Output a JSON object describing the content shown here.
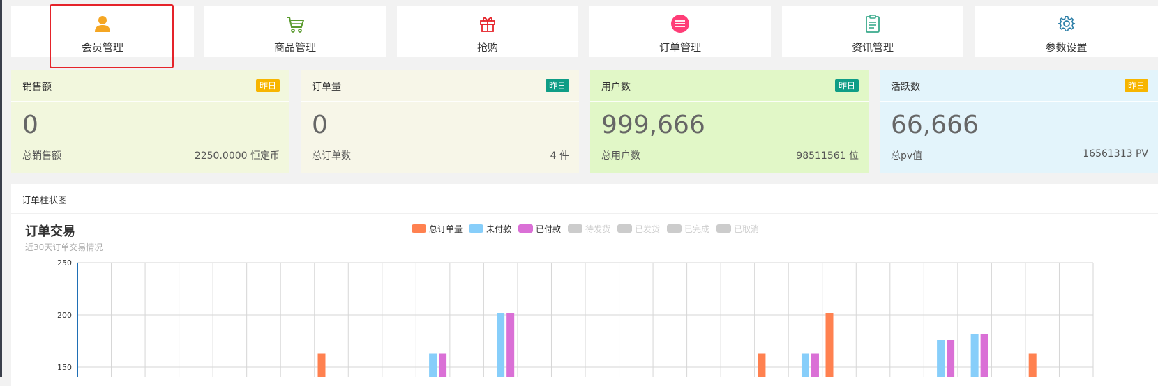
{
  "nav": [
    {
      "label": "会员管理",
      "icon": "user-icon",
      "color": "#f5a623"
    },
    {
      "label": "商品管理",
      "icon": "shopping-cart-icon",
      "color": "#5b9b2f"
    },
    {
      "label": "抢购",
      "icon": "gift-icon",
      "color": "#e5232a"
    },
    {
      "label": "订单管理",
      "icon": "list-circle-icon",
      "color": "#ff3d77"
    },
    {
      "label": "资讯管理",
      "icon": "clipboard-icon",
      "color": "#3aaa8c"
    },
    {
      "label": "参数设置",
      "icon": "gear-icon",
      "color": "#2a7da6"
    }
  ],
  "stats": [
    {
      "title": "销售额",
      "badge": "昨日",
      "badge_color": "#f7b500",
      "bg": "#f2f7dd",
      "value": "0",
      "sub_label": "总销售额",
      "sub_value": "2250.0000 恒定币"
    },
    {
      "title": "订单量",
      "badge": "昨日",
      "badge_color": "#0f9d86",
      "bg": "#f7f6e8",
      "value": "0",
      "sub_label": "总订单数",
      "sub_value": "4 件"
    },
    {
      "title": "用户数",
      "badge": "昨日",
      "badge_color": "#0f9d86",
      "bg": "#e1f7c7",
      "value": "999,666",
      "sub_label": "总用户数",
      "sub_value": "98511561 位"
    },
    {
      "title": "活跃数",
      "badge": "昨日",
      "badge_color": "#f7b500",
      "bg": "#e3f4fb",
      "value": "66,666",
      "sub_label": "总pv值",
      "sub_value": "16561313 PV"
    }
  ],
  "panel": {
    "title": "订单柱状图"
  },
  "chart_data": {
    "type": "bar",
    "title": "订单交易",
    "subtitle": "近30天订单交易情况",
    "ylim": [
      0,
      250
    ],
    "y_ticks": [
      150,
      200,
      250
    ],
    "grid": true,
    "legend_position": "top-center",
    "categories_count": 30,
    "series": [
      {
        "name": "总订单量",
        "color": "#ff8150",
        "active": true,
        "values": [
          0,
          0,
          0,
          0,
          0,
          0,
          0,
          163,
          0,
          0,
          0,
          0,
          0,
          0,
          0,
          0,
          0,
          0,
          0,
          0,
          163,
          0,
          202,
          0,
          0,
          0,
          0,
          0,
          163,
          0
        ]
      },
      {
        "name": "未付款",
        "color": "#87cefa",
        "active": true,
        "values": [
          0,
          0,
          0,
          0,
          0,
          0,
          0,
          0,
          0,
          0,
          163,
          0,
          202,
          0,
          0,
          0,
          0,
          0,
          0,
          0,
          0,
          163,
          0,
          0,
          0,
          176,
          182,
          0,
          0,
          0
        ]
      },
      {
        "name": "已付款",
        "color": "#da70d6",
        "active": true,
        "values": [
          0,
          0,
          0,
          0,
          0,
          0,
          0,
          0,
          0,
          0,
          163,
          0,
          202,
          0,
          0,
          0,
          0,
          0,
          0,
          0,
          0,
          163,
          0,
          0,
          0,
          176,
          182,
          0,
          0,
          0
        ]
      },
      {
        "name": "待发货",
        "color": "#cccccc",
        "active": false,
        "values": []
      },
      {
        "name": "已发货",
        "color": "#cccccc",
        "active": false,
        "values": []
      },
      {
        "name": "已完成",
        "color": "#cccccc",
        "active": false,
        "values": []
      },
      {
        "name": "已取消",
        "color": "#cccccc",
        "active": false,
        "values": []
      }
    ]
  }
}
